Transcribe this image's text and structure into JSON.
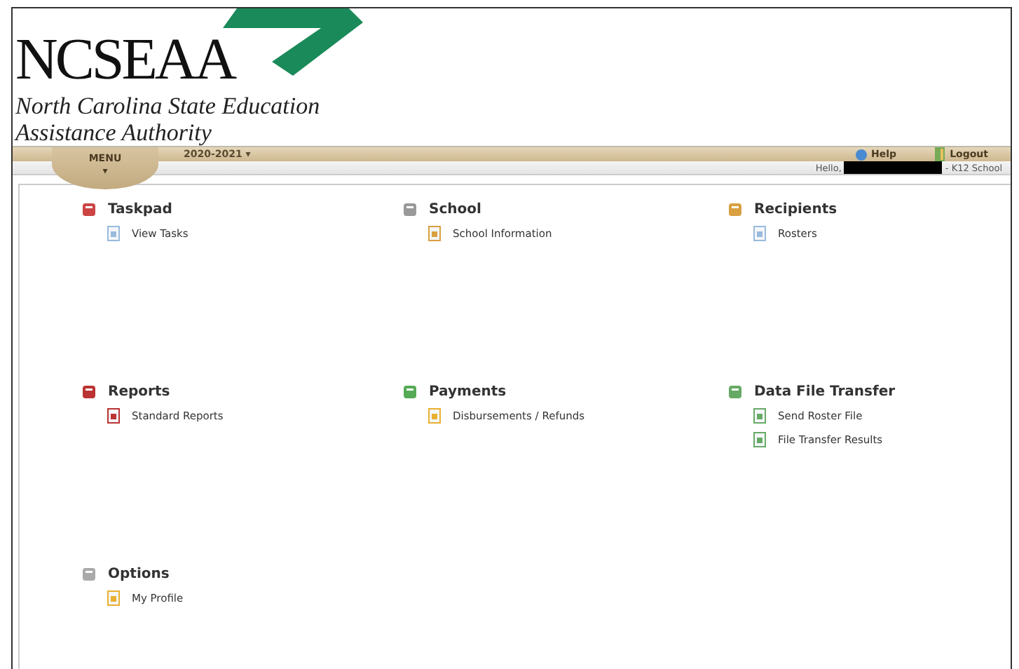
{
  "logo": {
    "name": "NCSEAA",
    "subtitle_lines": [
      "North Carolina State Education",
      "Assistance Authority"
    ]
  },
  "menu_bar": {
    "menu": "MENU",
    "menu_caret": "▾",
    "year": "2020-2021 ▾",
    "links": [
      "Help",
      "Logout"
    ]
  },
  "greeting": {
    "hello": "Hello,",
    "suffix": "- K12 School"
  },
  "sections": [
    {
      "title": "Taskpad",
      "items": [
        "View Tasks"
      ]
    },
    {
      "title": "School",
      "items": [
        "School Information"
      ]
    },
    {
      "title": "Recipients",
      "items": [
        "Rosters"
      ]
    },
    {
      "title": "Reports",
      "items": [
        "Standard Reports"
      ]
    },
    {
      "title": "Payments",
      "items": [
        "Disbursements / Refunds"
      ]
    },
    {
      "title": "Data File Transfer",
      "items": [
        "Send Roster File",
        "File Transfer Results"
      ]
    },
    {
      "title": "Options",
      "items": [
        "My Profile"
      ]
    }
  ]
}
